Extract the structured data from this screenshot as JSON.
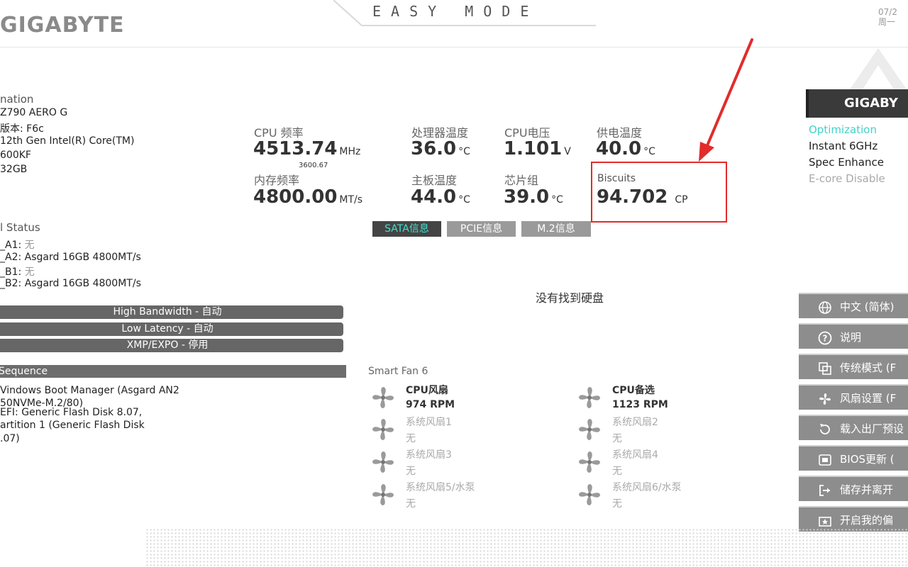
{
  "header": {
    "logo": "GIGABYTE",
    "mode_title": "EASY MODE",
    "date_line1": "07/2",
    "date_line2": "周一"
  },
  "info": {
    "section_title": "nation",
    "lines": [
      "Z790 AERO G",
      "版本: F6c",
      "12th Gen Intel(R) Core(TM)",
      "600KF",
      "32GB"
    ]
  },
  "dram": {
    "title": "l Status",
    "slots": [
      {
        "label": "_A1:",
        "value": "无"
      },
      {
        "label": "_A2:",
        "value": "Asgard 16GB 4800MT/s"
      },
      {
        "label": "_B1:",
        "value": "无"
      },
      {
        "label": "_B2:",
        "value": "Asgard 16GB 4800MT/s"
      }
    ]
  },
  "profiles": [
    {
      "label": "High Bandwidth - 自动"
    },
    {
      "label": "Low Latency - 自动"
    },
    {
      "label": "XMP/EXPO - 停用"
    }
  ],
  "boot": {
    "title": "Sequence",
    "lines": [
      "Vindows Boot Manager (Asgard AN2",
      "50NVMe-M.2/80)",
      "EFI: Generic Flash Disk 8.07,",
      "artition 1 (Generic Flash Disk",
      ".07)"
    ]
  },
  "metrics": {
    "cpu_freq": {
      "label": "CPU 频率",
      "value": "4513.74",
      "unit": "MHz",
      "sub": "3600.67"
    },
    "cpu_temp": {
      "label": "处理器温度",
      "value": "36.0",
      "unit": "°C"
    },
    "cpu_volt": {
      "label": "CPU电压",
      "value": "1.101",
      "unit": "V"
    },
    "vrm_temp": {
      "label": "供电温度",
      "value": "40.0",
      "unit": "°C"
    },
    "mem_freq": {
      "label": "内存频率",
      "value": "4800.00",
      "unit": "MT/s"
    },
    "mb_temp": {
      "label": "主板温度",
      "value": "44.0",
      "unit": "°C"
    },
    "chipset": {
      "label": "芯片组",
      "value": "39.0",
      "unit": "°C"
    },
    "biscuits": {
      "label": "Biscuits",
      "value": "94.702",
      "unit": "CP"
    }
  },
  "storage_tabs": [
    {
      "label": "SATA信息",
      "active": true
    },
    {
      "label": "PCIE信息",
      "active": false
    },
    {
      "label": "M.2信息",
      "active": false
    }
  ],
  "no_disk": "没有找到硬盘",
  "fans": {
    "title": "Smart Fan 6",
    "items": [
      {
        "name": "CPU风扇",
        "rpm": "974 RPM",
        "on": true
      },
      {
        "name": "CPU备选",
        "rpm": "1123 RPM",
        "on": true
      },
      {
        "name": "系统风扇1",
        "rpm": "无",
        "on": false
      },
      {
        "name": "系统风扇2",
        "rpm": "无",
        "on": false
      },
      {
        "name": "系统风扇3",
        "rpm": "无",
        "on": false
      },
      {
        "name": "系统风扇4",
        "rpm": "无",
        "on": false
      },
      {
        "name": "系统风扇5/水泵",
        "rpm": "无",
        "on": false
      },
      {
        "name": "系统风扇6/水泵",
        "rpm": "无",
        "on": false
      }
    ]
  },
  "right_panel": {
    "brand": "GIGABY",
    "options": [
      {
        "label": "Optimization",
        "state": "active"
      },
      {
        "label": "Instant 6GHz",
        "state": "normal"
      },
      {
        "label": "Spec Enhance",
        "state": "normal"
      },
      {
        "label": "E-core Disable",
        "state": "dim"
      }
    ],
    "buttons": [
      {
        "label": "中文 (简体)",
        "icon": "globe-icon"
      },
      {
        "label": "说明",
        "icon": "help-icon"
      },
      {
        "label": "传统模式 (F",
        "icon": "classic-mode-icon"
      },
      {
        "label": "风扇设置 (F",
        "icon": "fan-icon"
      },
      {
        "label": "载入出厂预设",
        "icon": "reset-icon"
      },
      {
        "label": "BIOS更新 (",
        "icon": "bios-update-icon"
      },
      {
        "label": "储存并离开",
        "icon": "exit-icon"
      },
      {
        "label": "开启我的偏",
        "icon": "favorites-icon"
      }
    ]
  },
  "colors": {
    "accent": "#3fd3c8",
    "highlight": "#e22b2b",
    "arrow": "#e22b2b"
  }
}
